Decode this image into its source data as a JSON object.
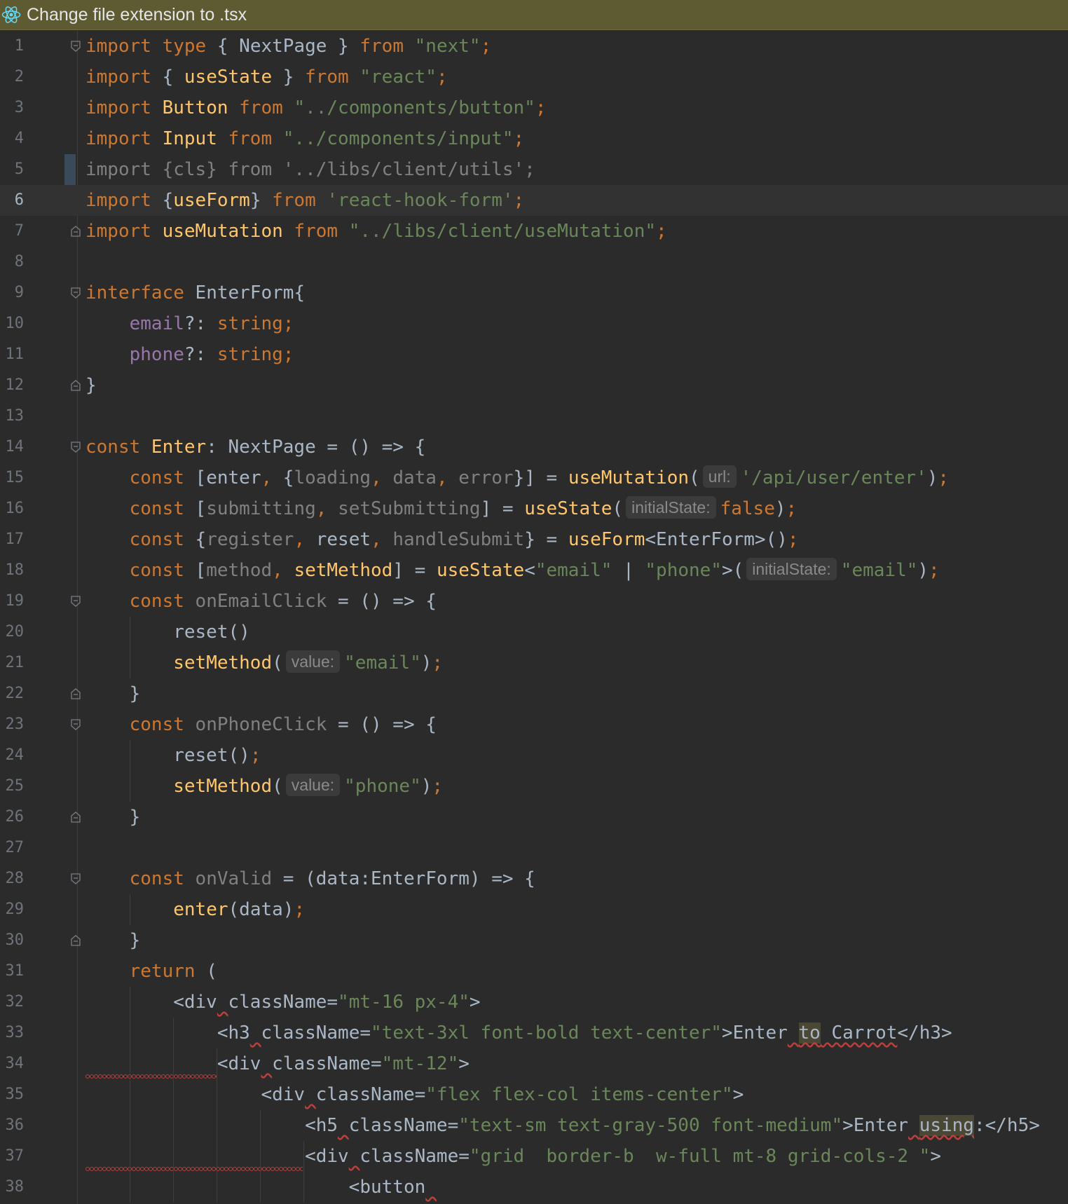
{
  "banner": {
    "icon": "react-icon",
    "text": "Change file extension to .tsx"
  },
  "editor": {
    "current_line": 6,
    "line_numbers": [
      "1",
      "2",
      "3",
      "4",
      "5",
      "6",
      "7",
      "8",
      "9",
      "10",
      "11",
      "12",
      "13",
      "14",
      "15",
      "16",
      "17",
      "18",
      "19",
      "20",
      "21",
      "22",
      "23",
      "24",
      "25",
      "26",
      "27",
      "28",
      "29",
      "30",
      "31",
      "32",
      "33",
      "34",
      "35",
      "36",
      "37",
      "38"
    ],
    "lines": [
      [
        [
          "k",
          "import "
        ],
        [
          "k",
          "type "
        ],
        [
          "",
          "{ NextPage } "
        ],
        [
          "k",
          "from "
        ],
        [
          "s",
          "\"next\""
        ],
        [
          "k",
          ";"
        ]
      ],
      [
        [
          "k",
          "import "
        ],
        [
          "",
          "{ "
        ],
        [
          "f",
          "useState"
        ],
        [
          "",
          " } "
        ],
        [
          "k",
          "from "
        ],
        [
          "s",
          "\"react\""
        ],
        [
          "k",
          ";"
        ]
      ],
      [
        [
          "k",
          "import "
        ],
        [
          "f",
          "Button "
        ],
        [
          "k",
          "from "
        ],
        [
          "s",
          "\"../components/button\""
        ],
        [
          "k",
          ";"
        ]
      ],
      [
        [
          "k",
          "import "
        ],
        [
          "f",
          "Input "
        ],
        [
          "k",
          "from "
        ],
        [
          "s",
          "\"../components/input\""
        ],
        [
          "k",
          ";"
        ]
      ],
      [
        [
          "d",
          "import {cls} from '../libs/client/utils';"
        ]
      ],
      [
        [
          "k",
          "import "
        ],
        [
          "",
          "{"
        ],
        [
          "f",
          "useForm"
        ],
        [
          "",
          "} "
        ],
        [
          "k",
          "from "
        ],
        [
          "s",
          "'react-hook-form'"
        ],
        [
          "k",
          ";"
        ]
      ],
      [
        [
          "k",
          "import "
        ],
        [
          "f",
          "useMutation "
        ],
        [
          "k",
          "from "
        ],
        [
          "s",
          "\"../libs/client/useMutation\""
        ],
        [
          "k",
          ";"
        ]
      ],
      [],
      [
        [
          "k",
          "interface "
        ],
        [
          "",
          "EnterForm{"
        ]
      ],
      [
        [
          "",
          "    "
        ],
        [
          "p",
          "email"
        ],
        [
          "",
          "?: "
        ],
        [
          "k",
          "string;"
        ]
      ],
      [
        [
          "",
          "    "
        ],
        [
          "p",
          "phone"
        ],
        [
          "",
          "?: "
        ],
        [
          "k",
          "string;"
        ]
      ],
      [
        [
          "",
          "}"
        ]
      ],
      [],
      [
        [
          "k",
          "const "
        ],
        [
          "f",
          "Enter"
        ],
        [
          "",
          ": NextPage = () => {"
        ]
      ],
      [
        [
          "",
          "    "
        ],
        [
          "k",
          "const "
        ],
        [
          "",
          "[enter"
        ],
        [
          "k",
          ", "
        ],
        [
          "",
          "{"
        ],
        [
          "d",
          "loading"
        ],
        [
          "k",
          ", "
        ],
        [
          "d",
          "data"
        ],
        [
          "k",
          ", "
        ],
        [
          "d",
          "error"
        ],
        [
          "",
          "}] = "
        ],
        [
          "f",
          "useMutation"
        ],
        [
          "",
          "("
        ],
        [
          "h",
          "url:"
        ],
        [
          "s",
          "'/api/user/enter'"
        ],
        [
          "",
          ")"
        ],
        [
          "k",
          ";"
        ]
      ],
      [
        [
          "",
          "    "
        ],
        [
          "k",
          "const "
        ],
        [
          "",
          "["
        ],
        [
          "d",
          "submitting"
        ],
        [
          "k",
          ", "
        ],
        [
          "d",
          "setSubmitting"
        ],
        [
          "",
          "] = "
        ],
        [
          "f",
          "useState"
        ],
        [
          "",
          "("
        ],
        [
          "h",
          "initialState:"
        ],
        [
          "k",
          "false"
        ],
        [
          "",
          ")"
        ],
        [
          "k",
          ";"
        ]
      ],
      [
        [
          "",
          "    "
        ],
        [
          "k",
          "const "
        ],
        [
          "",
          "{"
        ],
        [
          "d",
          "register"
        ],
        [
          "k",
          ", "
        ],
        [
          "",
          "reset"
        ],
        [
          "k",
          ", "
        ],
        [
          "d",
          "handleSubmit"
        ],
        [
          "",
          "} = "
        ],
        [
          "f",
          "useForm"
        ],
        [
          "",
          "<EnterForm>()"
        ],
        [
          "k",
          ";"
        ]
      ],
      [
        [
          "",
          "    "
        ],
        [
          "k",
          "const "
        ],
        [
          "",
          "["
        ],
        [
          "d",
          "method"
        ],
        [
          "k",
          ", "
        ],
        [
          "f",
          "setMethod"
        ],
        [
          "",
          "] = "
        ],
        [
          "f",
          "useState"
        ],
        [
          "",
          "<"
        ],
        [
          "s",
          "\"email\""
        ],
        [
          "",
          " | "
        ],
        [
          "s",
          "\"phone\""
        ],
        [
          "",
          ">("
        ],
        [
          "h",
          "initialState:"
        ],
        [
          "s",
          "\"email\""
        ],
        [
          "",
          ")"
        ],
        [
          "k",
          ";"
        ]
      ],
      [
        [
          "",
          "    "
        ],
        [
          "k",
          "const "
        ],
        [
          "d",
          "onEmailClick"
        ],
        [
          "",
          " = () => {"
        ]
      ],
      [
        [
          "",
          "        reset()"
        ]
      ],
      [
        [
          "",
          "        "
        ],
        [
          "f",
          "setMethod"
        ],
        [
          "",
          "("
        ],
        [
          "h",
          "value:"
        ],
        [
          "s",
          "\"email\""
        ],
        [
          "",
          ")"
        ],
        [
          "k",
          ";"
        ]
      ],
      [
        [
          "",
          "    }"
        ]
      ],
      [
        [
          "",
          "    "
        ],
        [
          "k",
          "const "
        ],
        [
          "d",
          "onPhoneClick"
        ],
        [
          "",
          " = () => {"
        ]
      ],
      [
        [
          "",
          "        reset()"
        ],
        [
          "k",
          ";"
        ]
      ],
      [
        [
          "",
          "        "
        ],
        [
          "f",
          "setMethod"
        ],
        [
          "",
          "("
        ],
        [
          "h",
          "value:"
        ],
        [
          "s",
          "\"phone\""
        ],
        [
          "",
          ")"
        ],
        [
          "k",
          ";"
        ]
      ],
      [
        [
          "",
          "    }"
        ]
      ],
      [],
      [
        [
          "",
          "    "
        ],
        [
          "k",
          "const "
        ],
        [
          "d",
          "onValid"
        ],
        [
          "",
          " = (data:EnterForm) => {"
        ]
      ],
      [
        [
          "",
          "        "
        ],
        [
          "f",
          "enter"
        ],
        [
          "",
          "(data)"
        ],
        [
          "k",
          ";"
        ]
      ],
      [
        [
          "",
          "    }"
        ]
      ],
      [
        [
          "",
          "    "
        ],
        [
          "k",
          "return "
        ],
        [
          "",
          "("
        ]
      ],
      [
        [
          "",
          "        <div"
        ],
        [
          "w",
          " "
        ],
        [
          "",
          "className="
        ],
        [
          "s",
          "\"mt-16 px-4\""
        ],
        [
          "",
          ">"
        ]
      ],
      [
        [
          "",
          "            <h3"
        ],
        [
          "w",
          " "
        ],
        [
          "",
          "className="
        ],
        [
          "s",
          "\"text-3xl font-bold text-center\""
        ],
        [
          "",
          ">Enter"
        ],
        [
          "w",
          " "
        ],
        [
          "x",
          "to"
        ],
        [
          "w",
          " Carrot"
        ],
        [
          "",
          "</h3>"
        ]
      ],
      [
        [
          "",
          "            <div"
        ],
        [
          "w",
          " "
        ],
        [
          "",
          "className="
        ],
        [
          "s",
          "\"mt-12\""
        ],
        [
          "",
          ">"
        ]
      ],
      [
        [
          "",
          "                <div"
        ],
        [
          "w",
          " "
        ],
        [
          "",
          "className="
        ],
        [
          "s",
          "\"flex flex-col items-center\""
        ],
        [
          "",
          ">"
        ]
      ],
      [
        [
          "",
          "                    <h5"
        ],
        [
          "w",
          " "
        ],
        [
          "",
          "className="
        ],
        [
          "s",
          "\"text-sm text-gray-500 font-medium\""
        ],
        [
          "",
          ">Enter"
        ],
        [
          "w",
          " "
        ],
        [
          "x",
          "using"
        ],
        [
          "",
          ":</h5>"
        ]
      ],
      [
        [
          "",
          "                    <div"
        ],
        [
          "w",
          " "
        ],
        [
          "",
          "className="
        ],
        [
          "s",
          "\"grid  border-b  w-full mt-8 grid-cols-2 \""
        ],
        [
          "",
          ">"
        ]
      ],
      [
        [
          "",
          "                        <button"
        ],
        [
          "w",
          " "
        ]
      ]
    ]
  }
}
